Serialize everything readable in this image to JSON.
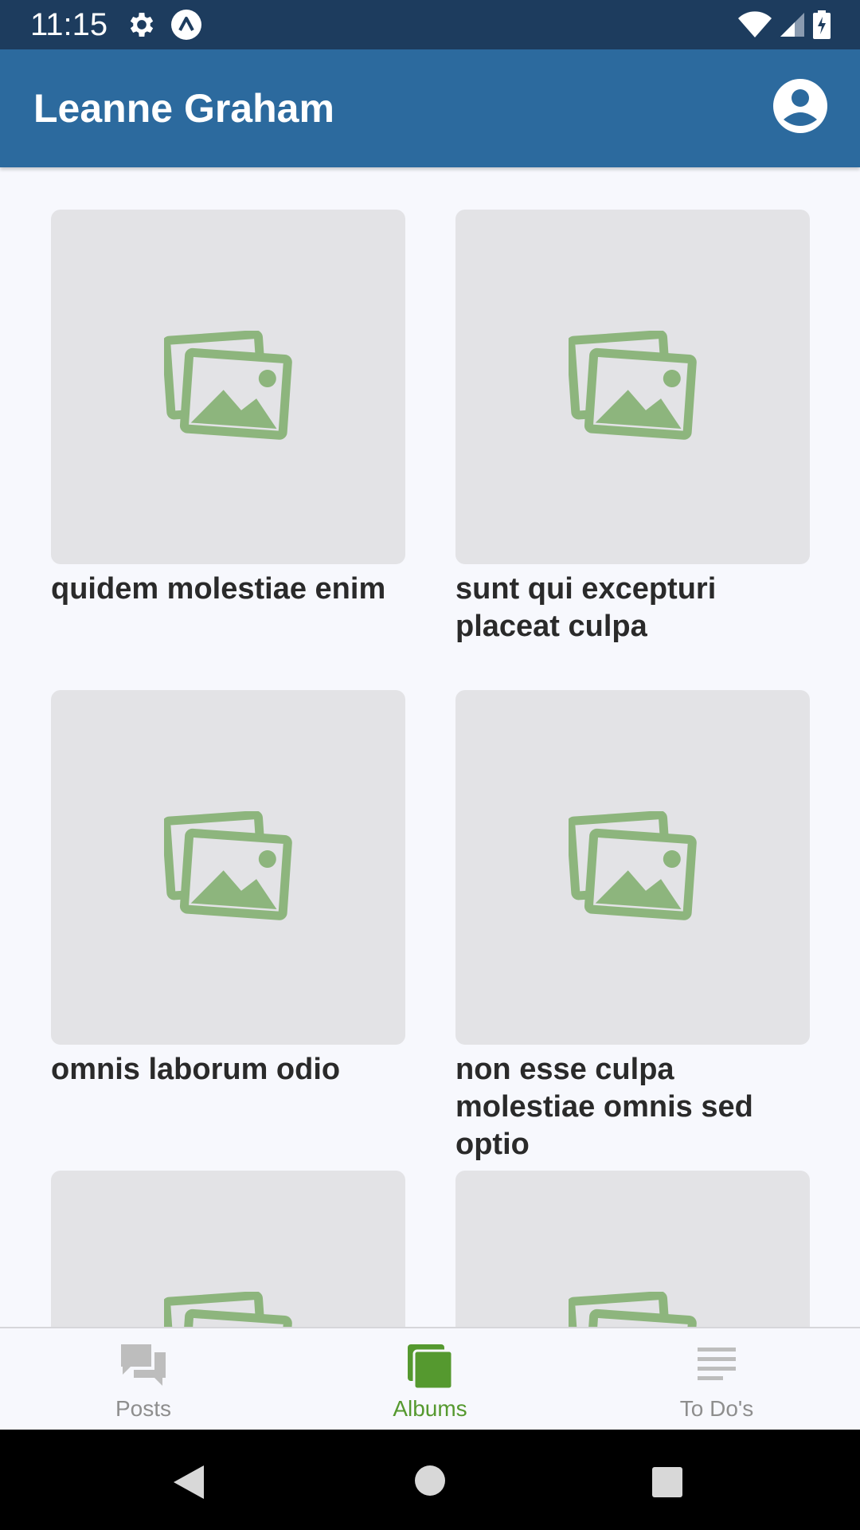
{
  "status_bar": {
    "time": "11:15",
    "left_icons": [
      "gear-icon",
      "app-notification-icon"
    ],
    "right_icons": [
      "wifi-icon",
      "signal-icon",
      "battery-icon"
    ]
  },
  "app_bar": {
    "title": "Leanne Graham",
    "profile_icon": "account-circle-icon"
  },
  "albums": [
    {
      "title": "quidem molestiae enim"
    },
    {
      "title": "sunt qui excepturi placeat culpa"
    },
    {
      "title": "omnis laborum odio"
    },
    {
      "title": "non esse culpa molestiae omnis sed optio"
    },
    {
      "title": ""
    },
    {
      "title": ""
    }
  ],
  "bottom_nav": {
    "items": [
      {
        "label": "Posts",
        "icon": "chat-bubbles-icon",
        "active": false
      },
      {
        "label": "Albums",
        "icon": "albums-icon",
        "active": true
      },
      {
        "label": "To Do's",
        "icon": "list-lines-icon",
        "active": false
      }
    ]
  },
  "system_nav": [
    "back-button",
    "home-button",
    "recents-button"
  ],
  "colors": {
    "status_bar": "#1d3c5e",
    "app_bar": "#2c6a9e",
    "accent_green": "#55992f",
    "placeholder_icon": "#8db57d",
    "background": "#f7f8fd"
  }
}
